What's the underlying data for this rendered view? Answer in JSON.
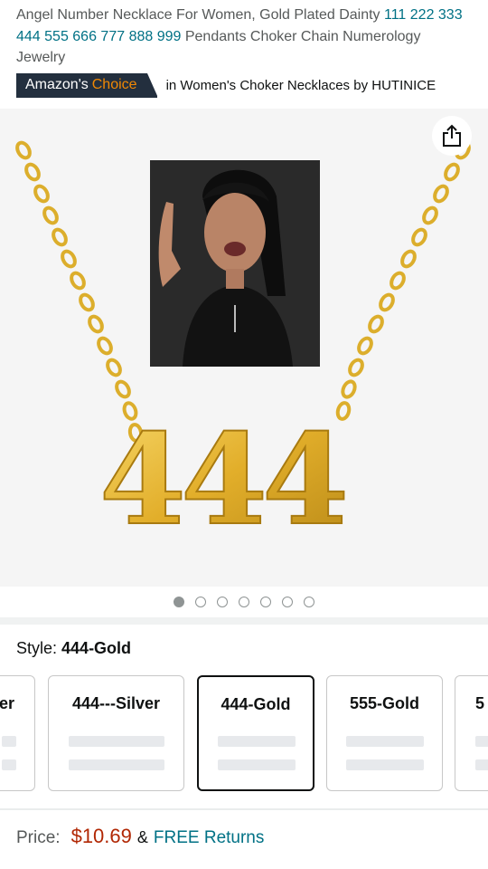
{
  "product": {
    "title_prefix": "Angel Number Necklace For Women, Gold Plated Dainty ",
    "title_numbers": "111 222 333 444 555 666 777 888 999",
    "title_suffix": " Pendants Choker Chain Numerology Jewelry"
  },
  "badge": {
    "amazons": "Amazon's",
    "choice": "Choice",
    "category_text": "in Women's Choker Necklaces by HUTINICE"
  },
  "gallery": {
    "pendant_text": "444",
    "dot_count": 7,
    "active_dot": 0
  },
  "style": {
    "label": "Style: ",
    "selected": "444-Gold",
    "options": [
      "er",
      "444---Silver",
      "444-Gold",
      "555-Gold",
      "5"
    ]
  },
  "pricing": {
    "label": "Price:",
    "price": "$10.69",
    "amp": "&",
    "returns": "FREE Returns"
  },
  "colors": {
    "accent_teal": "#007185",
    "price_red": "#b12704",
    "badge_navy": "#232f3e",
    "choice_orange": "#f08804",
    "gold": "#e8b923"
  }
}
